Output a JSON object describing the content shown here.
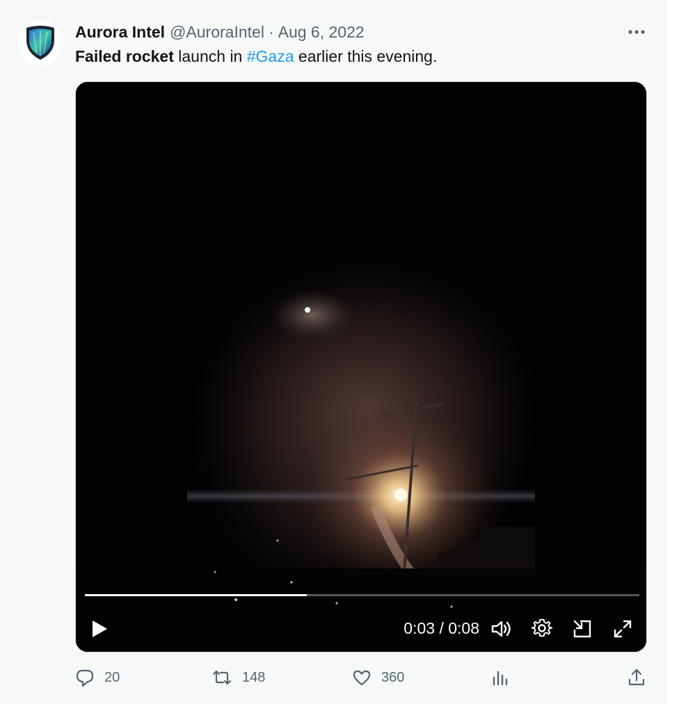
{
  "tweet": {
    "author": {
      "display_name": "Aurora Intel",
      "handle": "@AuroraIntel",
      "separator": "·",
      "date": "Aug 6, 2022",
      "avatar_icon": "shield-logo"
    },
    "text": {
      "bold": "Failed rocket",
      "part1": " launch in ",
      "hashtag": "#Gaza",
      "part2": " earlier this evening."
    },
    "more_icon": "more-horizontal-icon"
  },
  "video": {
    "time_display": "0:03 / 0:08",
    "progress_fraction": 0.4,
    "controls": [
      "play-icon",
      "volume-icon",
      "settings-icon",
      "picture-in-picture-icon",
      "fullscreen-icon"
    ]
  },
  "actions": {
    "reply_count": "20",
    "retweet_count": "148",
    "like_count": "360",
    "icons": [
      "reply-icon",
      "retweet-icon",
      "like-icon",
      "views-icon",
      "share-icon"
    ]
  },
  "colors": {
    "link": "#1d9bf0",
    "secondary_text": "#536471",
    "background": "#f7f9f9"
  }
}
